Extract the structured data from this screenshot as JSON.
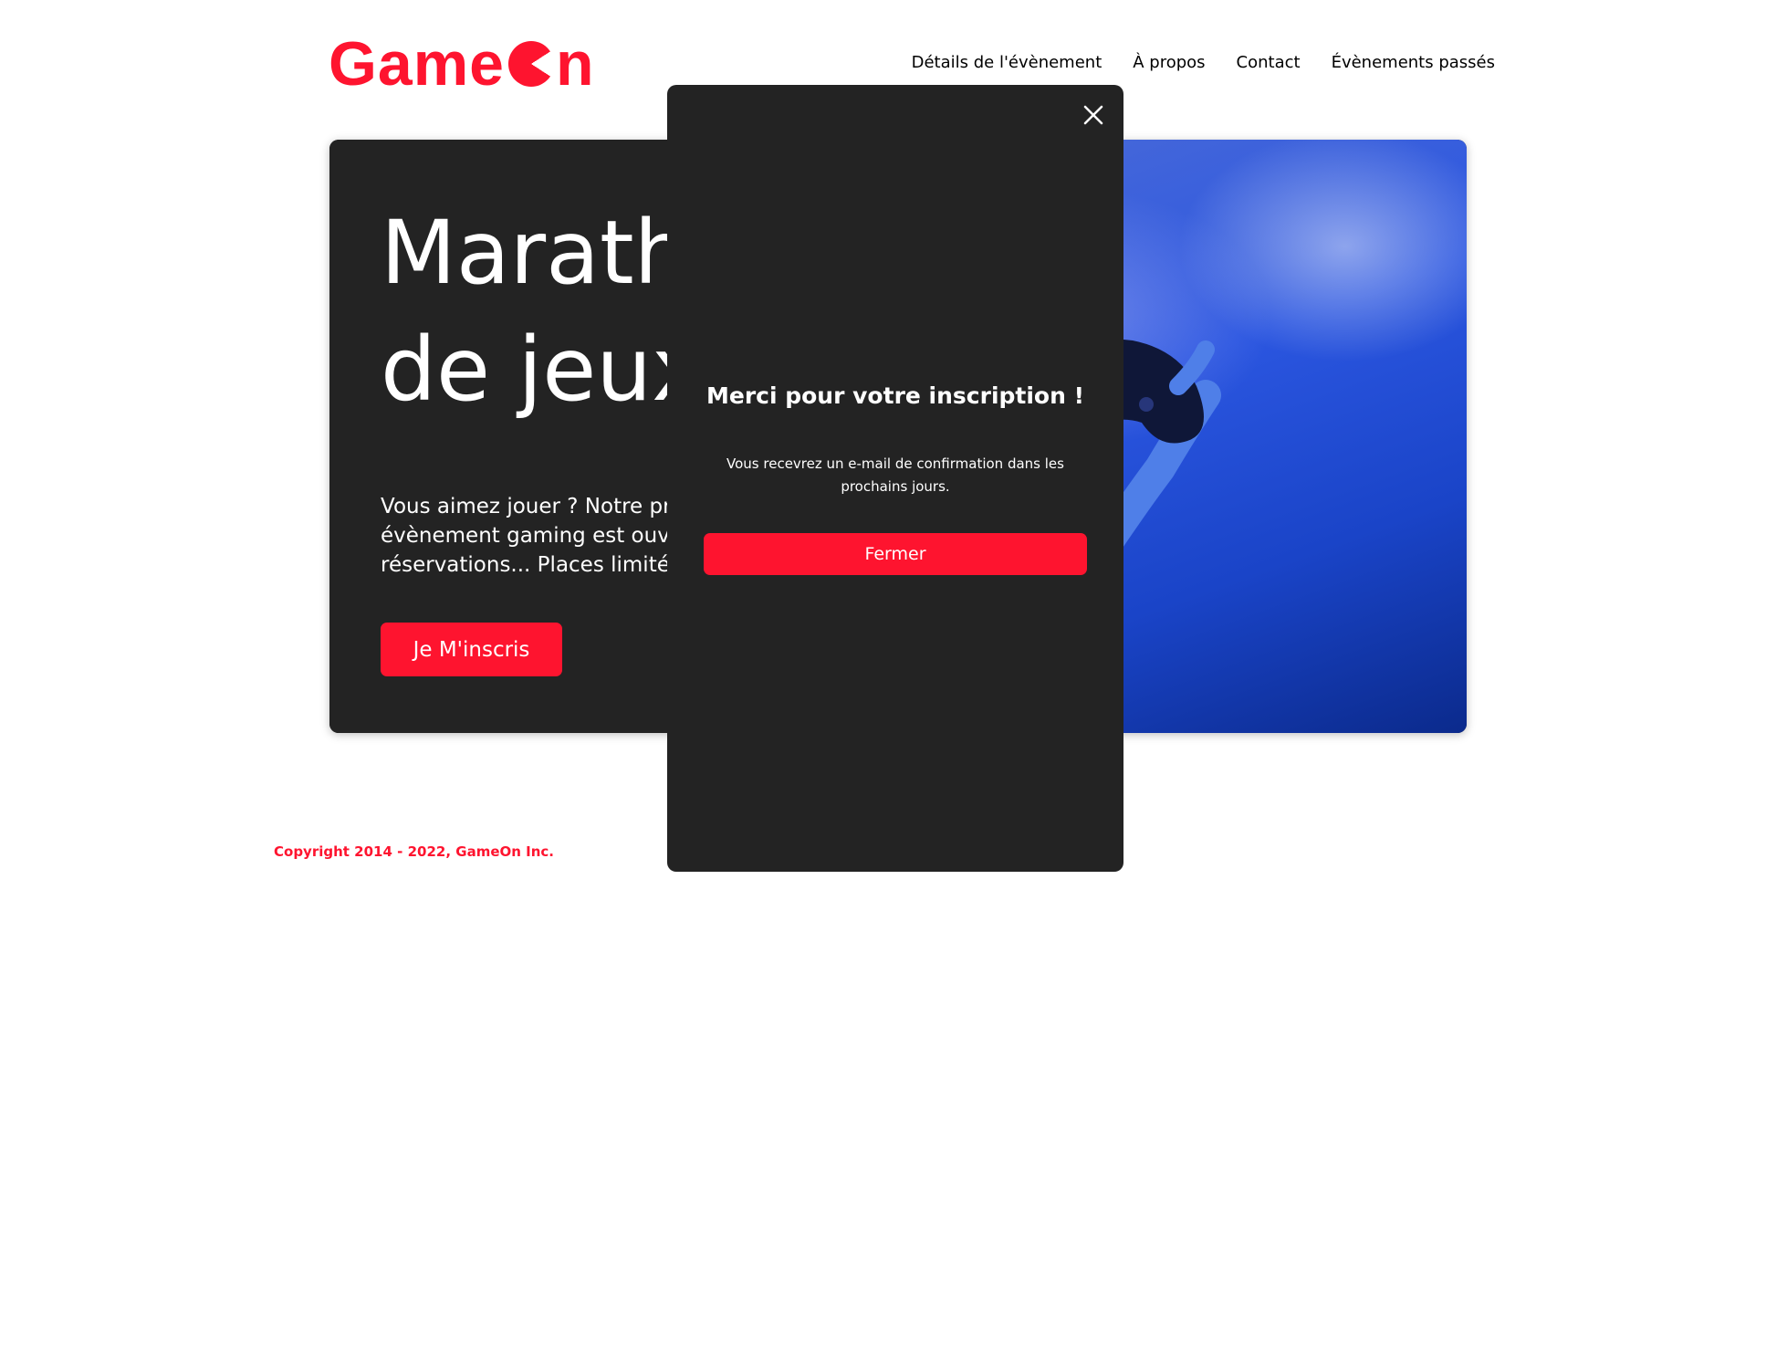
{
  "header": {
    "logo_text_start": "Game",
    "logo_text_end": "n",
    "nav": [
      {
        "label": "Détails de l'évènement"
      },
      {
        "label": "À propos"
      },
      {
        "label": "Contact"
      },
      {
        "label": "Évènements passés"
      }
    ]
  },
  "hero": {
    "title": "Marath\nde jeux",
    "description": "Vous aimez jouer ? Notre pro\névènement gaming est ouve\nréservations... Places limitées",
    "cta_label": "Je M'inscris",
    "image_icon": "gamer-with-controller-photo"
  },
  "modal": {
    "title": "Merci pour votre inscription !",
    "message": "Vous recevrez un e-mail de confirmation dans les prochains jours.",
    "close_button_label": "Fermer",
    "close_icon": "close-icon"
  },
  "footer": {
    "copyright": "Copyright 2014 - 2022, GameOn Inc."
  },
  "colors": {
    "accent": "#fe142f",
    "dark": "#232323"
  }
}
